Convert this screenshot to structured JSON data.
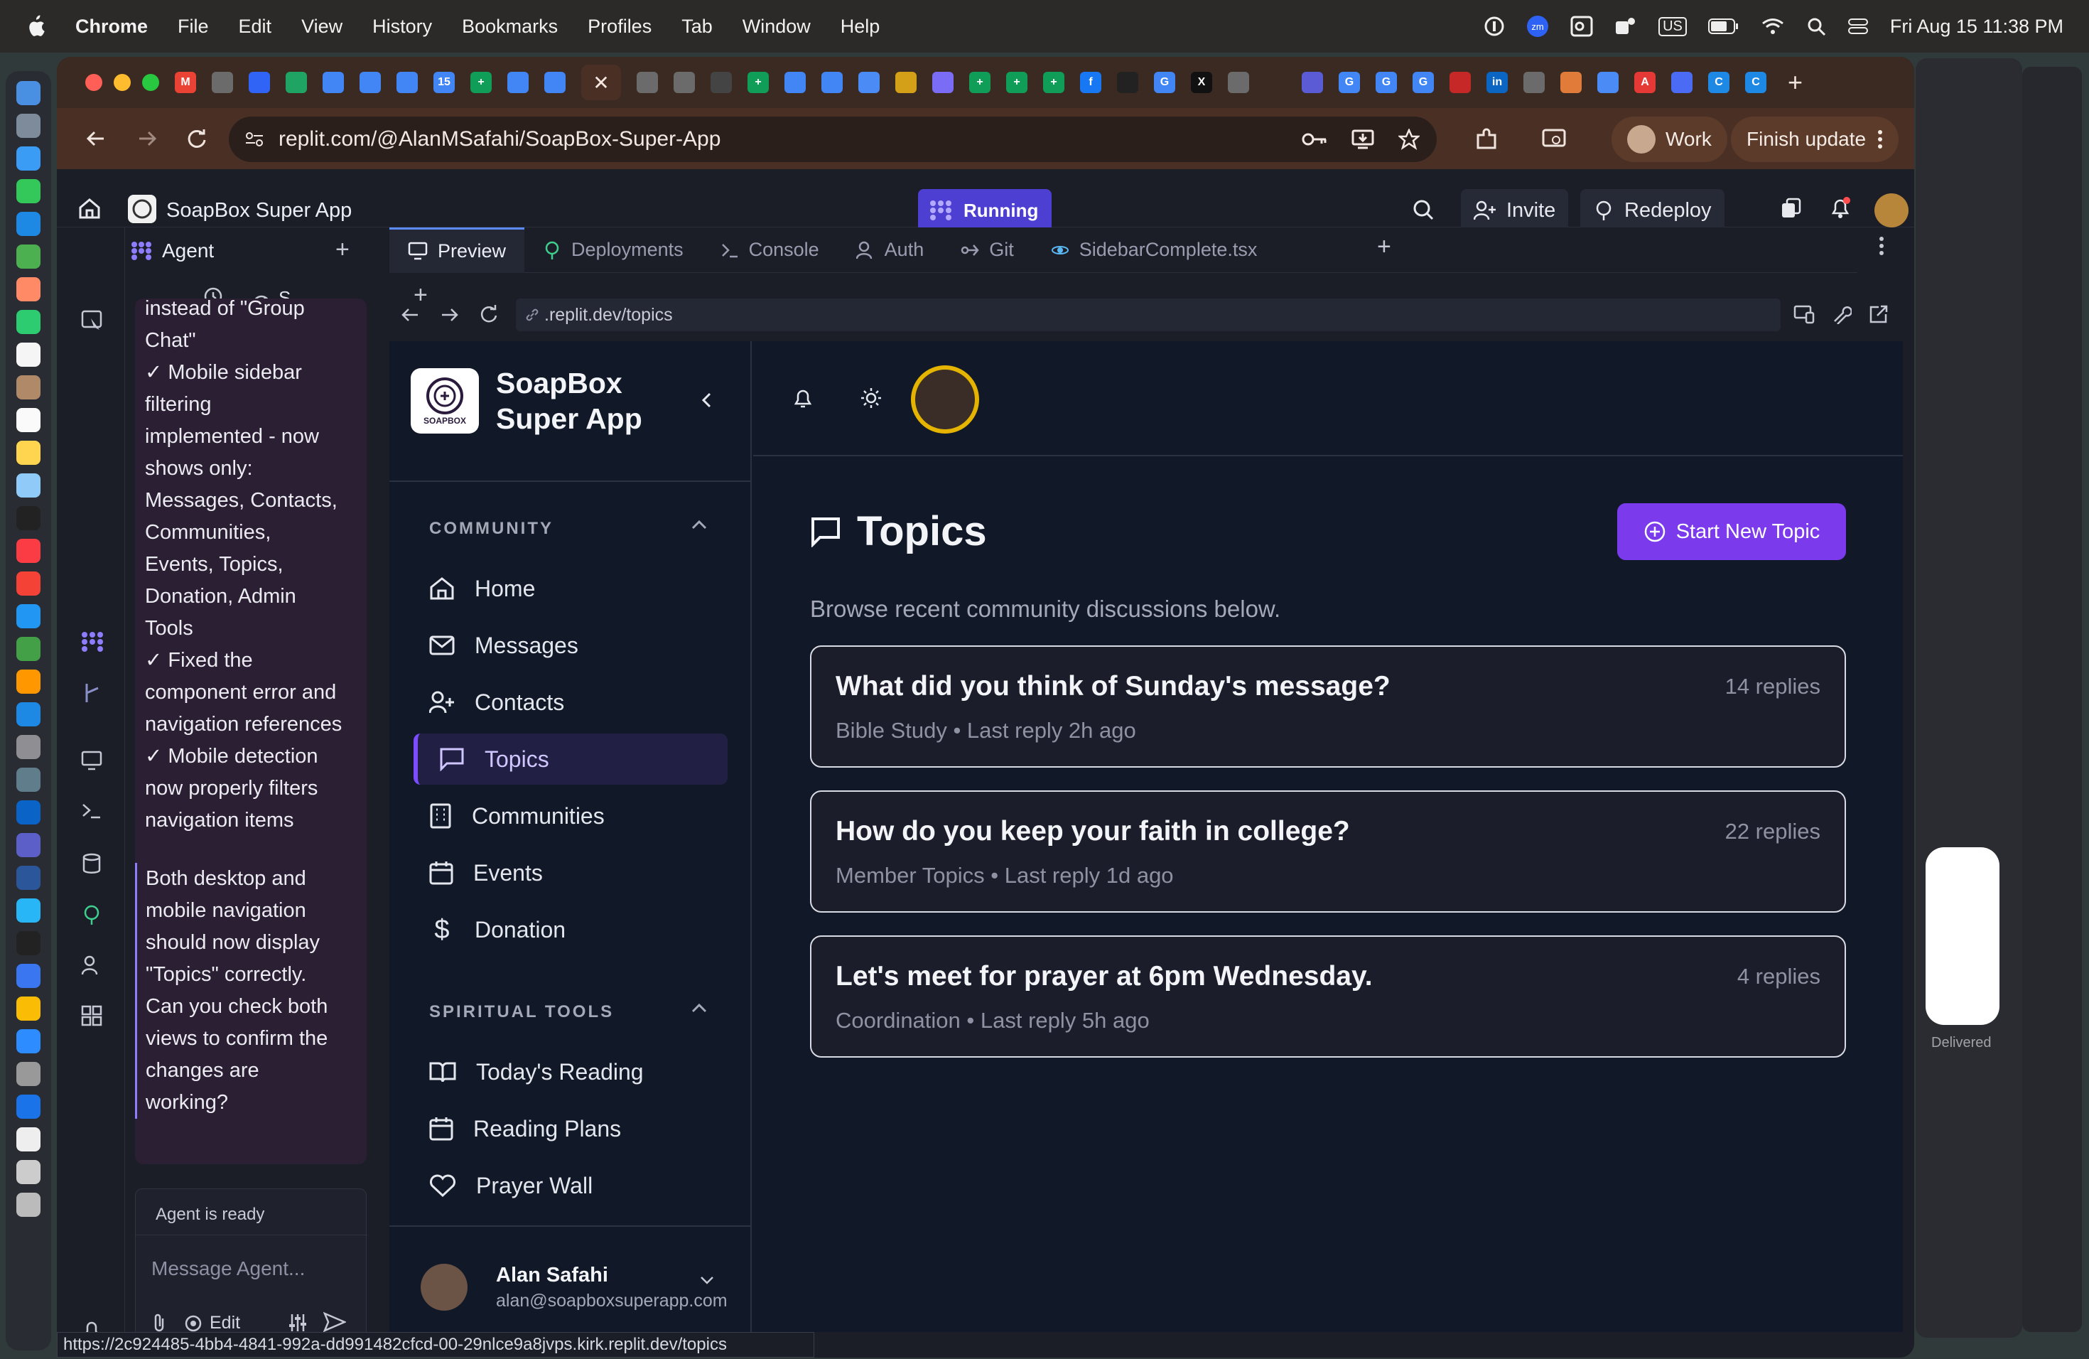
{
  "menubar": {
    "app": "Chrome",
    "items": [
      "File",
      "Edit",
      "View",
      "History",
      "Bookmarks",
      "Profiles",
      "Tab",
      "Window",
      "Help"
    ],
    "datetime": "Fri Aug 15  11:38 PM",
    "input_source": "US"
  },
  "browser": {
    "url": "replit.com/@AlanMSafahi/SoapBox-Super-App",
    "profile": "Work",
    "finish_update": "Finish update",
    "favicons": [
      {
        "letter": "M",
        "color": "#ea4335"
      },
      {
        "letter": "",
        "color": "#6b6b6b"
      },
      {
        "letter": "",
        "color": "#2f64f6"
      },
      {
        "letter": "",
        "color": "#1fa463"
      },
      {
        "letter": "",
        "color": "#4285f4"
      },
      {
        "letter": "",
        "color": "#4285f4"
      },
      {
        "letter": "",
        "color": "#4285f4"
      },
      {
        "letter": "15",
        "color": "#4285f4"
      },
      {
        "letter": "+",
        "color": "#0f9d58"
      },
      {
        "letter": "",
        "color": "#4285f4"
      },
      {
        "letter": "",
        "color": "#4285f4"
      }
    ],
    "favicons_right": [
      {
        "letter": "",
        "color": "#6b6b6b"
      },
      {
        "letter": "",
        "color": "#6b6b6b"
      },
      {
        "letter": "",
        "color": "#444"
      },
      {
        "letter": "+",
        "color": "#0f9d58"
      },
      {
        "letter": "",
        "color": "#4285f4"
      },
      {
        "letter": "",
        "color": "#4285f4"
      },
      {
        "letter": "",
        "color": "#4b8bf5"
      },
      {
        "letter": "",
        "color": "#d4a017"
      },
      {
        "letter": "",
        "color": "#7b6cf5"
      },
      {
        "letter": "+",
        "color": "#0f9d58"
      },
      {
        "letter": "+",
        "color": "#0f9d58"
      },
      {
        "letter": "+",
        "color": "#0f9d58"
      },
      {
        "letter": "f",
        "color": "#1877f2"
      },
      {
        "letter": "",
        "color": "#222"
      },
      {
        "letter": "G",
        "color": "#4285f4"
      },
      {
        "letter": "X",
        "color": "#111"
      },
      {
        "letter": "",
        "color": "#6b6b6b"
      },
      {
        "letter": "",
        "color": "#3a2a22"
      },
      {
        "letter": "",
        "color": "#5b5bd6"
      },
      {
        "letter": "G",
        "color": "#4285f4"
      },
      {
        "letter": "G",
        "color": "#4285f4"
      },
      {
        "letter": "G",
        "color": "#4285f4"
      },
      {
        "letter": "",
        "color": "#c62828"
      },
      {
        "letter": "in",
        "color": "#0a66c2"
      },
      {
        "letter": "",
        "color": "#6b6b6b"
      },
      {
        "letter": "",
        "color": "#e07b39"
      },
      {
        "letter": "",
        "color": "#4b8bf5"
      },
      {
        "letter": "A",
        "color": "#e53935"
      },
      {
        "letter": "",
        "color": "#4b6bf5"
      },
      {
        "letter": "C",
        "color": "#1e88e5"
      },
      {
        "letter": "C",
        "color": "#1e88e5"
      }
    ]
  },
  "replit": {
    "project_title": "SoapBox Super App",
    "running_label": "Running",
    "invite": "Invite",
    "redeploy": "Redeploy",
    "agent_tab": "Agent",
    "agent_subtab": "S...",
    "agent_status": "Agent is ready",
    "message_placeholder": "Message Agent...",
    "edit_label": "Edit",
    "agent_lines": [
      "instead of \"Group",
      "Chat\"",
      "✓ Mobile sidebar",
      "filtering",
      "implemented - now",
      "shows only:",
      "Messages, Contacts,",
      "Communities,",
      "Events, Topics,",
      "Donation, Admin",
      "Tools",
      "✓ Fixed the",
      "component error and",
      "navigation references",
      "✓ Mobile detection",
      "now properly filters",
      "navigation items"
    ],
    "agent_lines2": [
      "Both desktop and",
      "mobile navigation",
      "should now display",
      "\"Topics\" correctly.",
      "Can you check both",
      "views to confirm the",
      "changes are",
      "working?"
    ],
    "workspace_tabs": [
      {
        "label": "Preview",
        "active": true
      },
      {
        "label": "Deployments",
        "active": false
      },
      {
        "label": "Console",
        "active": false
      },
      {
        "label": "Auth",
        "active": false
      },
      {
        "label": "Git",
        "active": false
      },
      {
        "label": "SidebarComplete.tsx",
        "active": false
      }
    ],
    "preview_url": ".replit.dev/topics"
  },
  "app": {
    "brand_line1": "SoapBox",
    "brand_line2": "Super App",
    "logo_text": "SOAPBOX",
    "community_title": "COMMUNITY",
    "nav": [
      "Home",
      "Messages",
      "Contacts",
      "Topics",
      "Communities",
      "Events",
      "Donation"
    ],
    "active_nav": "Topics",
    "spiritual_title": "SPIRITUAL TOOLS",
    "spiritual": [
      "Today's Reading",
      "Reading Plans",
      "Prayer Wall"
    ],
    "user_name": "Alan Safahi",
    "user_email": "alan@soapboxsuperapp.com",
    "page_title": "Topics",
    "page_subtitle": "Browse recent community discussions below.",
    "new_topic_button": "Start New Topic",
    "topics": [
      {
        "title": "What did you think of Sunday's message?",
        "group": "Bible Study",
        "last": "Last reply 2h ago",
        "replies": "14 replies"
      },
      {
        "title": "How do you keep your faith in college?",
        "group": "Member Topics",
        "last": "Last reply 1d ago",
        "replies": "22 replies"
      },
      {
        "title": "Let's meet for prayer at 6pm Wednesday.",
        "group": "Coordination",
        "last": "Last reply 5h ago",
        "replies": "4 replies"
      }
    ]
  },
  "status_url": "https://2c924485-4bb4-4841-992a-dd991482cfcd-00-29nlce9a8jvps.kirk.replit.dev/topics",
  "side_window": {
    "delivered": "Delivered"
  },
  "colors": {
    "accent": "#7c3aed",
    "running": "#4d3fd1",
    "tab_bg": "#3b2a22"
  }
}
